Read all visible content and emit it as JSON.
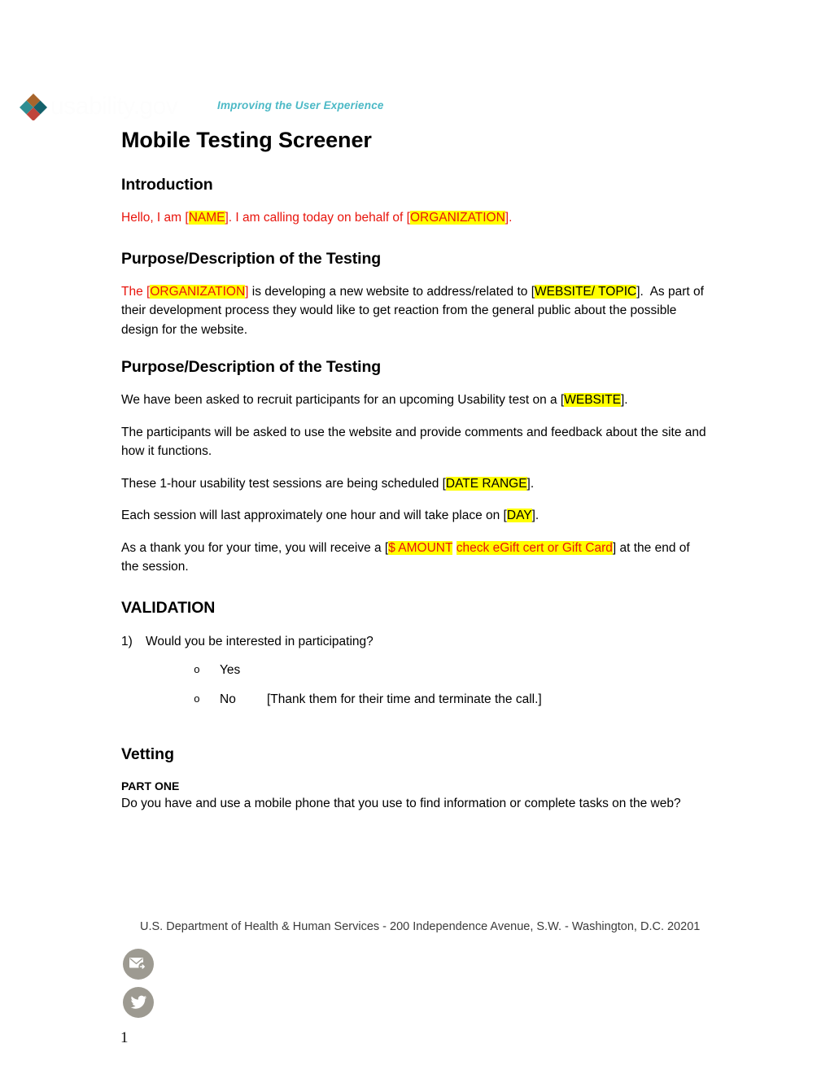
{
  "header": {
    "logo_icon": "usability-diamond-logo",
    "wordmark": "usability.gov",
    "tagline": "Improving the User Experience",
    "tagline_color": "#4cb9c6",
    "logo_colors": {
      "top": "#a8652c",
      "left": "#2f8e92",
      "right": "#14616b",
      "bottom": "#c0453c"
    }
  },
  "document": {
    "title": "Mobile Testing Screener",
    "sections": {
      "introduction_heading": "Introduction",
      "intro_line": {
        "part1": "Hello, I am [",
        "field1": "NAME",
        "part2": "]. I am calling today on behalf of [",
        "field2": "ORGANIZATION",
        "part3": "]."
      },
      "purpose_heading_1": "Purpose/Description of the Testing",
      "purpose_para_1": {
        "part1": "The [",
        "field1": "ORGANIZATION",
        "part2": "] is developing a new website to address/related to [",
        "field2": "WEBSITE/ TOPIC",
        "part3": "].  As part of their development process they would like to get reaction from the general public about the possible design for the website."
      },
      "purpose_heading_2": "Purpose/Description of the Testing",
      "purpose_para_2": {
        "part1": "We have been asked to recruit participants for an upcoming Usability test on a [",
        "field1": "WEBSITE",
        "part2": "]."
      },
      "participants_para": "The participants will be asked to use the website and provide comments and feedback about the site and how it functions.",
      "sessions_para": {
        "part1": "These 1-hour usability test sessions are being scheduled [",
        "field1": "DATE RANGE",
        "part2": "]."
      },
      "duration_para": {
        "part1": "Each session will last approximately one hour and will take place on [",
        "field1": "DAY",
        "part2": "]."
      },
      "incentive_para": {
        "part1": "As a thank you for your time, you will receive a [",
        "field1": "$ AMOUNT",
        "field2": "check eGift cert or Gift Card",
        "part2": "] at the end of the session."
      },
      "validation_heading": "VALIDATION",
      "validation_question": {
        "number": "1)",
        "text": "Would you be interested in participating?"
      },
      "validation_options": [
        {
          "bullet": "o",
          "label": "Yes",
          "note": ""
        },
        {
          "bullet": "o",
          "label": "No",
          "note": "[Thank them for their time and terminate the call.]"
        }
      ],
      "vetting_heading": "Vetting",
      "part_one_label": "PART ONE",
      "part_one_question": "Do you have and use a mobile phone that you use to find information or complete tasks on the web?"
    }
  },
  "footer": {
    "address": "U.S. Department of Health & Human Services - 200 Independence Avenue, S.W. - Washington, D.C. 20201",
    "social_icons": [
      {
        "name": "email-forward-icon"
      },
      {
        "name": "twitter-bird-icon"
      }
    ],
    "social_color": "#9d9a91",
    "page_number": "1"
  },
  "highlight_color": "#ffff00",
  "red_text_color": "#e8140c"
}
